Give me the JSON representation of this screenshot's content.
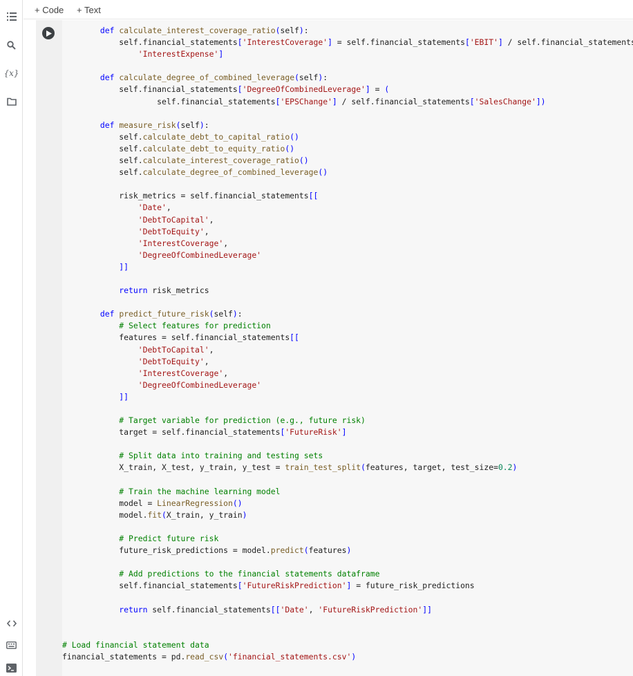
{
  "toolbar": {
    "add_code_label": "+ Code",
    "add_text_label": "+ Text"
  },
  "sidebar": {
    "icons": [
      "table-of-contents-icon",
      "search-icon",
      "variables-icon",
      "folder-icon",
      "code-snippets-icon",
      "command-palette-icon",
      "terminal-icon"
    ],
    "variables_label": "{x}"
  },
  "colors": {
    "keyword": "#0000ff",
    "string": "#a31515",
    "comment": "#008000",
    "number": "#098658",
    "cell_background": "#f7f7f7",
    "gutter_background": "#f0f0f0"
  },
  "cell": {
    "lines": [
      "        def calculate_interest_coverage_ratio(self):",
      "            self.financial_statements['InterestCoverage'] = self.financial_statements['EBIT'] / self.financial_statements[",
      "                'InterestExpense']",
      "",
      "        def calculate_degree_of_combined_leverage(self):",
      "            self.financial_statements['DegreeOfCombinedLeverage'] = (",
      "                    self.financial_statements['EPSChange'] / self.financial_statements['SalesChange'])",
      "",
      "        def measure_risk(self):",
      "            self.calculate_debt_to_capital_ratio()",
      "            self.calculate_debt_to_equity_ratio()",
      "            self.calculate_interest_coverage_ratio()",
      "            self.calculate_degree_of_combined_leverage()",
      "",
      "            risk_metrics = self.financial_statements[[",
      "                'Date',",
      "                'DebtToCapital',",
      "                'DebtToEquity',",
      "                'InterestCoverage',",
      "                'DegreeOfCombinedLeverage'",
      "            ]]",
      "",
      "            return risk_metrics",
      "",
      "        def predict_future_risk(self):",
      "            # Select features for prediction",
      "            features = self.financial_statements[[",
      "                'DebtToCapital',",
      "                'DebtToEquity',",
      "                'InterestCoverage',",
      "                'DegreeOfCombinedLeverage'",
      "            ]]",
      "",
      "            # Target variable for prediction (e.g., future risk)",
      "            target = self.financial_statements['FutureRisk']",
      "",
      "            # Split data into training and testing sets",
      "            X_train, X_test, y_train, y_test = train_test_split(features, target, test_size=0.2)",
      "",
      "            # Train the machine learning model",
      "            model = LinearRegression()",
      "            model.fit(X_train, y_train)",
      "",
      "            # Predict future risk",
      "            future_risk_predictions = model.predict(features)",
      "",
      "            # Add predictions to the financial statements dataframe",
      "            self.financial_statements['FutureRiskPrediction'] = future_risk_predictions",
      "",
      "            return self.financial_statements[['Date', 'FutureRiskPrediction']]",
      "",
      "",
      "# Load financial statement data",
      "financial_statements = pd.read_csv('financial_statements.csv')"
    ]
  }
}
